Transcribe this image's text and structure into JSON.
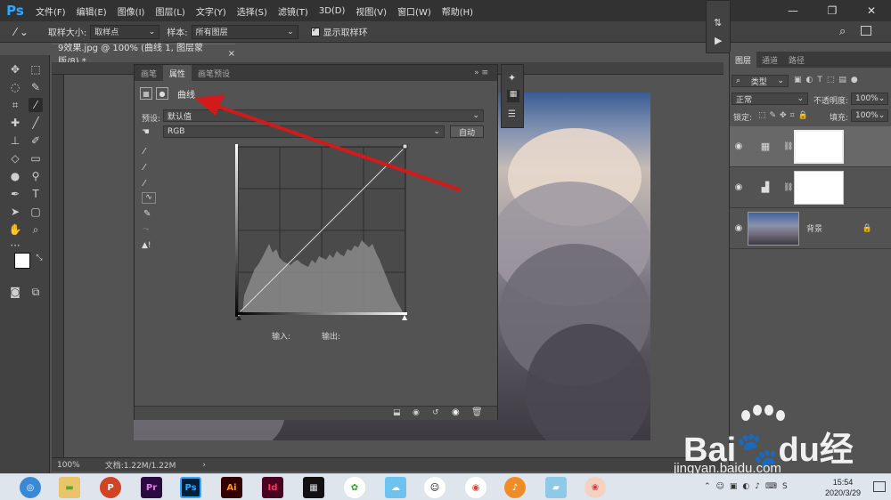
{
  "app": {
    "logo": "Ps"
  },
  "menu": [
    "文件(F)",
    "编辑(E)",
    "图像(I)",
    "图层(L)",
    "文字(Y)",
    "选择(S)",
    "滤镜(T)",
    "3D(D)",
    "视图(V)",
    "窗口(W)",
    "帮助(H)"
  ],
  "window_controls": [
    "—",
    "❐",
    "✕"
  ],
  "options": {
    "sample_size_label": "取样大小:",
    "sample_size_value": "取样点",
    "sample_label": "样本:",
    "sample_value": "所有图层",
    "show_ring_label": "显示取样环"
  },
  "document": {
    "tab_title": "9效果.jpg @ 100% (曲线 1, 图层蒙版/8) *",
    "close": "×",
    "zoom": "100%",
    "doc_info": "文档:1.22M/1.22M"
  },
  "properties": {
    "tabs": [
      "画笔",
      "属性",
      "画笔预设"
    ],
    "active_tab": 1,
    "title": "曲线",
    "preset_label": "预设:",
    "preset_value": "默认值",
    "channel_value": "RGB",
    "auto_label": "自动",
    "input_label": "输入:",
    "output_label": "输出:"
  },
  "layers": {
    "tabs": [
      "图层",
      "通道",
      "路径"
    ],
    "active_tab": 0,
    "filter_value": "类型",
    "blend_mode": "正常",
    "opacity_label": "不透明度:",
    "opacity_value": "100%",
    "lock_label": "锁定:",
    "fill_label": "填充:",
    "fill_value": "100%",
    "items": [
      {
        "name": "",
        "type": "curves-adjustment"
      },
      {
        "name": "",
        "type": "levels-adjustment"
      },
      {
        "name": "背景",
        "type": "image"
      }
    ]
  },
  "taskbar": {
    "time": "15:54",
    "date": "2020/3/29",
    "apps": [
      "Pr",
      "Ps",
      "Ai",
      "Id"
    ]
  },
  "watermark": {
    "text": "Bai🐾du经验",
    "url": "jingyan.baidu.com"
  },
  "colors": {
    "accent": "#31a8ff",
    "arrow": "#d21a1a",
    "panel": "#535353"
  }
}
